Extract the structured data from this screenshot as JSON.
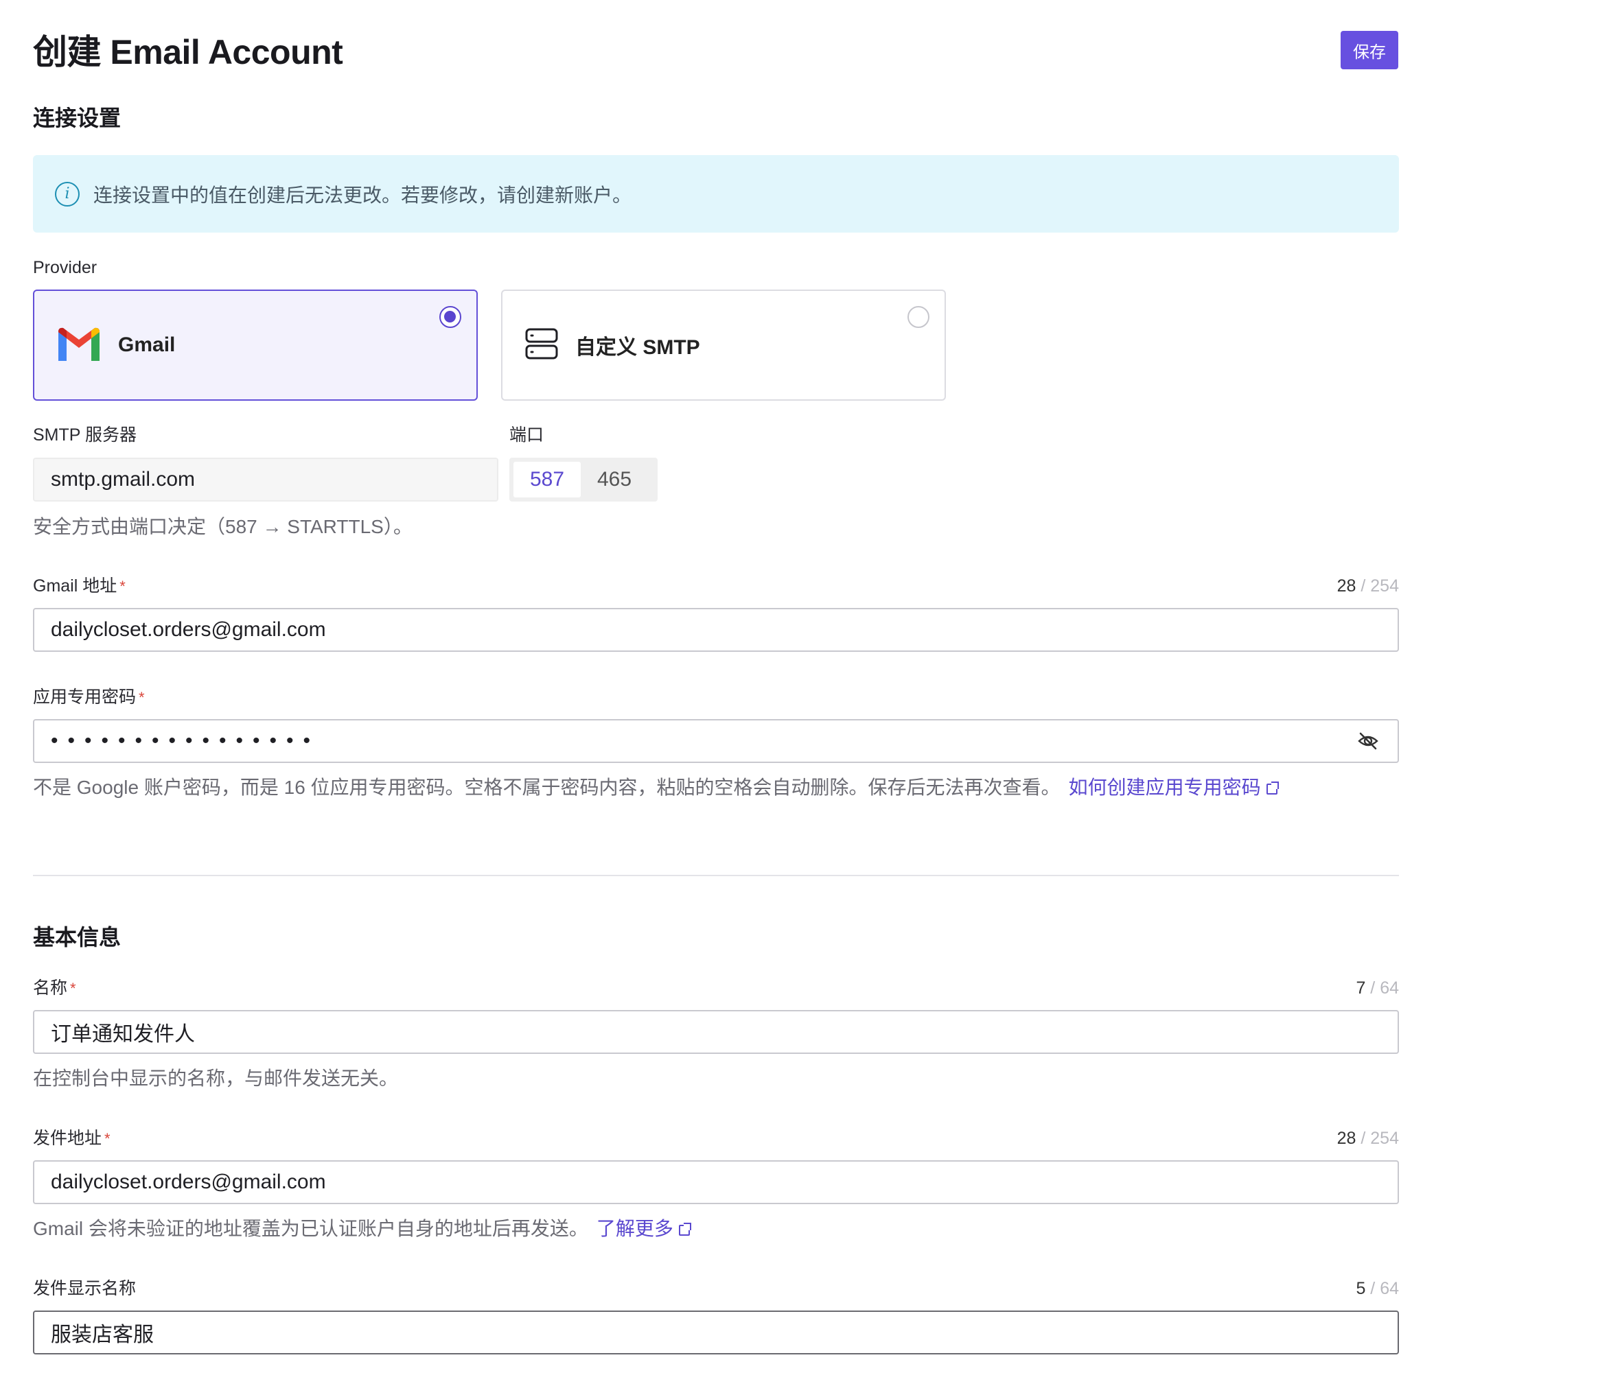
{
  "header": {
    "title": "创建 Email Account",
    "save_label": "保存"
  },
  "connection": {
    "title": "连接设置",
    "info": "连接设置中的值在创建后无法更改。若要修改，请创建新账户。",
    "provider_label": "Provider",
    "providers": [
      {
        "name": "Gmail",
        "selected": true
      },
      {
        "name": "自定义 SMTP",
        "selected": false
      }
    ],
    "smtp_label": "SMTP 服务器",
    "smtp_value": "smtp.gmail.com",
    "port_label": "端口",
    "ports": [
      "587",
      "465"
    ],
    "port_selected": "587",
    "security_help": "安全方式由端口决定（587 → STARTTLS）。",
    "gmail_label": "Gmail 地址",
    "gmail_count": "28",
    "gmail_max": "/ 254",
    "gmail_value": "dailycloset.orders@gmail.com",
    "password_label": "应用专用密码",
    "password_mask": "••••••••••••••••",
    "password_help": "不是 Google 账户密码，而是 16 位应用专用密码。空格不属于密码内容，粘贴的空格会自动删除。保存后无法再次查看。",
    "password_link": "如何创建应用专用密码"
  },
  "basic": {
    "title": "基本信息",
    "name_label": "名称",
    "name_count": "7",
    "name_max": "/ 64",
    "name_value": "订单通知发件人",
    "name_help": "在控制台中显示的名称，与邮件发送无关。",
    "from_label": "发件地址",
    "from_count": "28",
    "from_max": "/ 254",
    "from_value": "dailycloset.orders@gmail.com",
    "from_help": "Gmail 会将未验证的地址覆盖为已认证账户自身的地址后再发送。",
    "from_link": "了解更多",
    "display_label": "发件显示名称",
    "display_count": "5",
    "display_max": "/ 64",
    "display_value": "服装店客服"
  },
  "colors": {
    "accent": "#6750e0",
    "info_bg": "#e1f6fc",
    "required": "#d9453a"
  }
}
